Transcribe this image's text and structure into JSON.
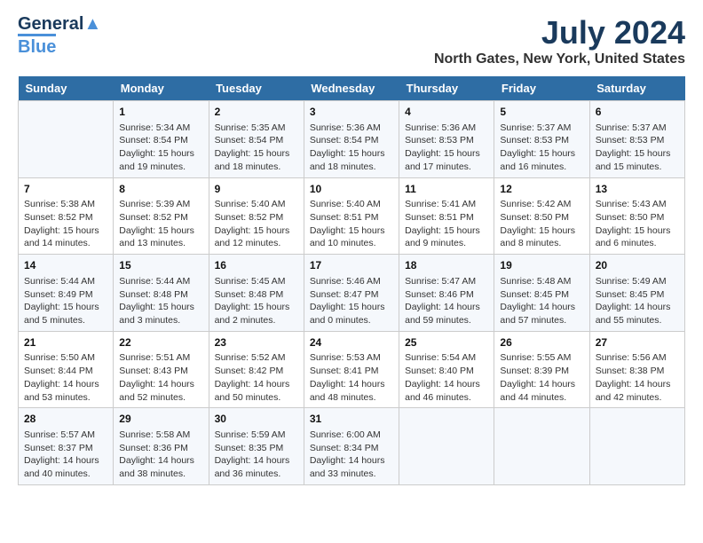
{
  "logo": {
    "line1": "General",
    "line2": "Blue"
  },
  "title": "July 2024",
  "subtitle": "North Gates, New York, United States",
  "headers": [
    "Sunday",
    "Monday",
    "Tuesday",
    "Wednesday",
    "Thursday",
    "Friday",
    "Saturday"
  ],
  "weeks": [
    [
      {
        "num": "",
        "info": ""
      },
      {
        "num": "1",
        "info": "Sunrise: 5:34 AM\nSunset: 8:54 PM\nDaylight: 15 hours and 19 minutes."
      },
      {
        "num": "2",
        "info": "Sunrise: 5:35 AM\nSunset: 8:54 PM\nDaylight: 15 hours and 18 minutes."
      },
      {
        "num": "3",
        "info": "Sunrise: 5:36 AM\nSunset: 8:54 PM\nDaylight: 15 hours and 18 minutes."
      },
      {
        "num": "4",
        "info": "Sunrise: 5:36 AM\nSunset: 8:53 PM\nDaylight: 15 hours and 17 minutes."
      },
      {
        "num": "5",
        "info": "Sunrise: 5:37 AM\nSunset: 8:53 PM\nDaylight: 15 hours and 16 minutes."
      },
      {
        "num": "6",
        "info": "Sunrise: 5:37 AM\nSunset: 8:53 PM\nDaylight: 15 hours and 15 minutes."
      }
    ],
    [
      {
        "num": "7",
        "info": "Sunrise: 5:38 AM\nSunset: 8:52 PM\nDaylight: 15 hours and 14 minutes."
      },
      {
        "num": "8",
        "info": "Sunrise: 5:39 AM\nSunset: 8:52 PM\nDaylight: 15 hours and 13 minutes."
      },
      {
        "num": "9",
        "info": "Sunrise: 5:40 AM\nSunset: 8:52 PM\nDaylight: 15 hours and 12 minutes."
      },
      {
        "num": "10",
        "info": "Sunrise: 5:40 AM\nSunset: 8:51 PM\nDaylight: 15 hours and 10 minutes."
      },
      {
        "num": "11",
        "info": "Sunrise: 5:41 AM\nSunset: 8:51 PM\nDaylight: 15 hours and 9 minutes."
      },
      {
        "num": "12",
        "info": "Sunrise: 5:42 AM\nSunset: 8:50 PM\nDaylight: 15 hours and 8 minutes."
      },
      {
        "num": "13",
        "info": "Sunrise: 5:43 AM\nSunset: 8:50 PM\nDaylight: 15 hours and 6 minutes."
      }
    ],
    [
      {
        "num": "14",
        "info": "Sunrise: 5:44 AM\nSunset: 8:49 PM\nDaylight: 15 hours and 5 minutes."
      },
      {
        "num": "15",
        "info": "Sunrise: 5:44 AM\nSunset: 8:48 PM\nDaylight: 15 hours and 3 minutes."
      },
      {
        "num": "16",
        "info": "Sunrise: 5:45 AM\nSunset: 8:48 PM\nDaylight: 15 hours and 2 minutes."
      },
      {
        "num": "17",
        "info": "Sunrise: 5:46 AM\nSunset: 8:47 PM\nDaylight: 15 hours and 0 minutes."
      },
      {
        "num": "18",
        "info": "Sunrise: 5:47 AM\nSunset: 8:46 PM\nDaylight: 14 hours and 59 minutes."
      },
      {
        "num": "19",
        "info": "Sunrise: 5:48 AM\nSunset: 8:45 PM\nDaylight: 14 hours and 57 minutes."
      },
      {
        "num": "20",
        "info": "Sunrise: 5:49 AM\nSunset: 8:45 PM\nDaylight: 14 hours and 55 minutes."
      }
    ],
    [
      {
        "num": "21",
        "info": "Sunrise: 5:50 AM\nSunset: 8:44 PM\nDaylight: 14 hours and 53 minutes."
      },
      {
        "num": "22",
        "info": "Sunrise: 5:51 AM\nSunset: 8:43 PM\nDaylight: 14 hours and 52 minutes."
      },
      {
        "num": "23",
        "info": "Sunrise: 5:52 AM\nSunset: 8:42 PM\nDaylight: 14 hours and 50 minutes."
      },
      {
        "num": "24",
        "info": "Sunrise: 5:53 AM\nSunset: 8:41 PM\nDaylight: 14 hours and 48 minutes."
      },
      {
        "num": "25",
        "info": "Sunrise: 5:54 AM\nSunset: 8:40 PM\nDaylight: 14 hours and 46 minutes."
      },
      {
        "num": "26",
        "info": "Sunrise: 5:55 AM\nSunset: 8:39 PM\nDaylight: 14 hours and 44 minutes."
      },
      {
        "num": "27",
        "info": "Sunrise: 5:56 AM\nSunset: 8:38 PM\nDaylight: 14 hours and 42 minutes."
      }
    ],
    [
      {
        "num": "28",
        "info": "Sunrise: 5:57 AM\nSunset: 8:37 PM\nDaylight: 14 hours and 40 minutes."
      },
      {
        "num": "29",
        "info": "Sunrise: 5:58 AM\nSunset: 8:36 PM\nDaylight: 14 hours and 38 minutes."
      },
      {
        "num": "30",
        "info": "Sunrise: 5:59 AM\nSunset: 8:35 PM\nDaylight: 14 hours and 36 minutes."
      },
      {
        "num": "31",
        "info": "Sunrise: 6:00 AM\nSunset: 8:34 PM\nDaylight: 14 hours and 33 minutes."
      },
      {
        "num": "",
        "info": ""
      },
      {
        "num": "",
        "info": ""
      },
      {
        "num": "",
        "info": ""
      }
    ]
  ]
}
